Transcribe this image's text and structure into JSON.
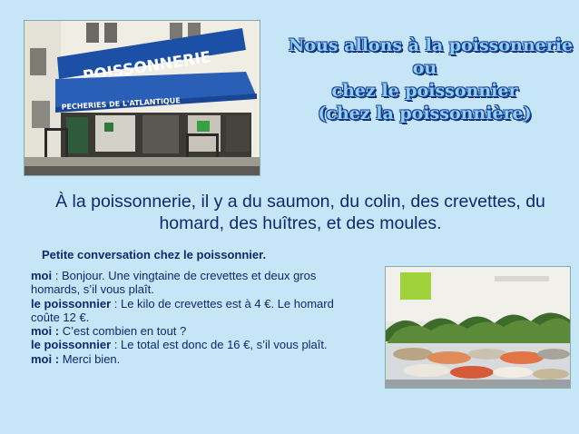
{
  "title": {
    "line1": "Nous allons à la poissonnerie",
    "line2": "ou",
    "line3": "chez le poissonnier",
    "line4": "(chez la poissonnière)"
  },
  "photo_shop": {
    "sign_text": "POISSONNERIE",
    "awning_text": "PECHERIES DE L'ATLANTIQUE"
  },
  "intro": "À la poissonnerie, il y a du saumon, du colin, des crevettes, du homard, des huîtres, et des moules.",
  "conversation": {
    "heading": "Petite conversation chez le poissonnier.",
    "lines": [
      {
        "speaker": "moi",
        "sep": " : ",
        "text": "Bonjour. Une vingtaine de crevettes et deux gros homards, s’il vous plaît."
      },
      {
        "speaker": "le poissonnier",
        "sep": " : ",
        "text": "Le kilo de crevettes est à 4 €. Le homard coûte 12 €."
      },
      {
        "speaker": "moi :",
        "sep": " ",
        "text": "C’est combien en tout ?"
      },
      {
        "speaker": "le poissonnier",
        "sep": " : ",
        "text": "Le total est donc de 16 €, s’il vous plaît."
      },
      {
        "speaker": "moi :",
        "sep": " ",
        "text": "Merci bien."
      }
    ]
  },
  "colors": {
    "background": "#c6e5f7",
    "text": "#0b2a6f",
    "title_fill": "#8fd0f4",
    "title_outline": "#1b3f94"
  }
}
